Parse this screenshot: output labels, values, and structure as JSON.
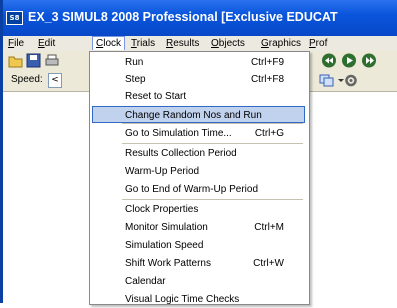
{
  "window": {
    "title": "EX_3   SIMUL8 2008 Professional [Exclusive EDUCAT",
    "icon_text": "S8",
    "accent": "#0a55dc"
  },
  "menubar": {
    "items": [
      {
        "label": "File"
      },
      {
        "label": "Edit"
      },
      {
        "label": "Clock"
      },
      {
        "label": "Trials"
      },
      {
        "label": "Results"
      },
      {
        "label": "Objects"
      },
      {
        "label": "Graphics"
      },
      {
        "label": "Prof"
      }
    ],
    "active": "Clock"
  },
  "toolbar": {
    "speed_label": "Speed:",
    "speed_arrow": "<"
  },
  "clock_menu": {
    "items": [
      {
        "label": "Run",
        "shortcut": "Ctrl+F9"
      },
      {
        "label": "Step",
        "shortcut": "Ctrl+F8"
      },
      {
        "label": "Reset to Start",
        "shortcut": ""
      },
      {
        "label": "Change Random Nos and Run",
        "shortcut": "",
        "highlighted": true
      },
      {
        "label": "Go to Simulation Time...",
        "shortcut": "Ctrl+G"
      },
      {
        "label": "Results Collection Period",
        "shortcut": ""
      },
      {
        "label": "Warm-Up Period",
        "shortcut": ""
      },
      {
        "label": "Go to End of Warm-Up Period",
        "shortcut": ""
      },
      {
        "label": "Clock Properties",
        "shortcut": ""
      },
      {
        "label": "Monitor Simulation",
        "shortcut": "Ctrl+M"
      },
      {
        "label": "Simulation Speed",
        "shortcut": ""
      },
      {
        "label": "Shift Work Patterns",
        "shortcut": "Ctrl+W"
      },
      {
        "label": "Calendar",
        "shortcut": ""
      },
      {
        "label": "Visual Logic Time Checks",
        "shortcut": ""
      }
    ]
  }
}
